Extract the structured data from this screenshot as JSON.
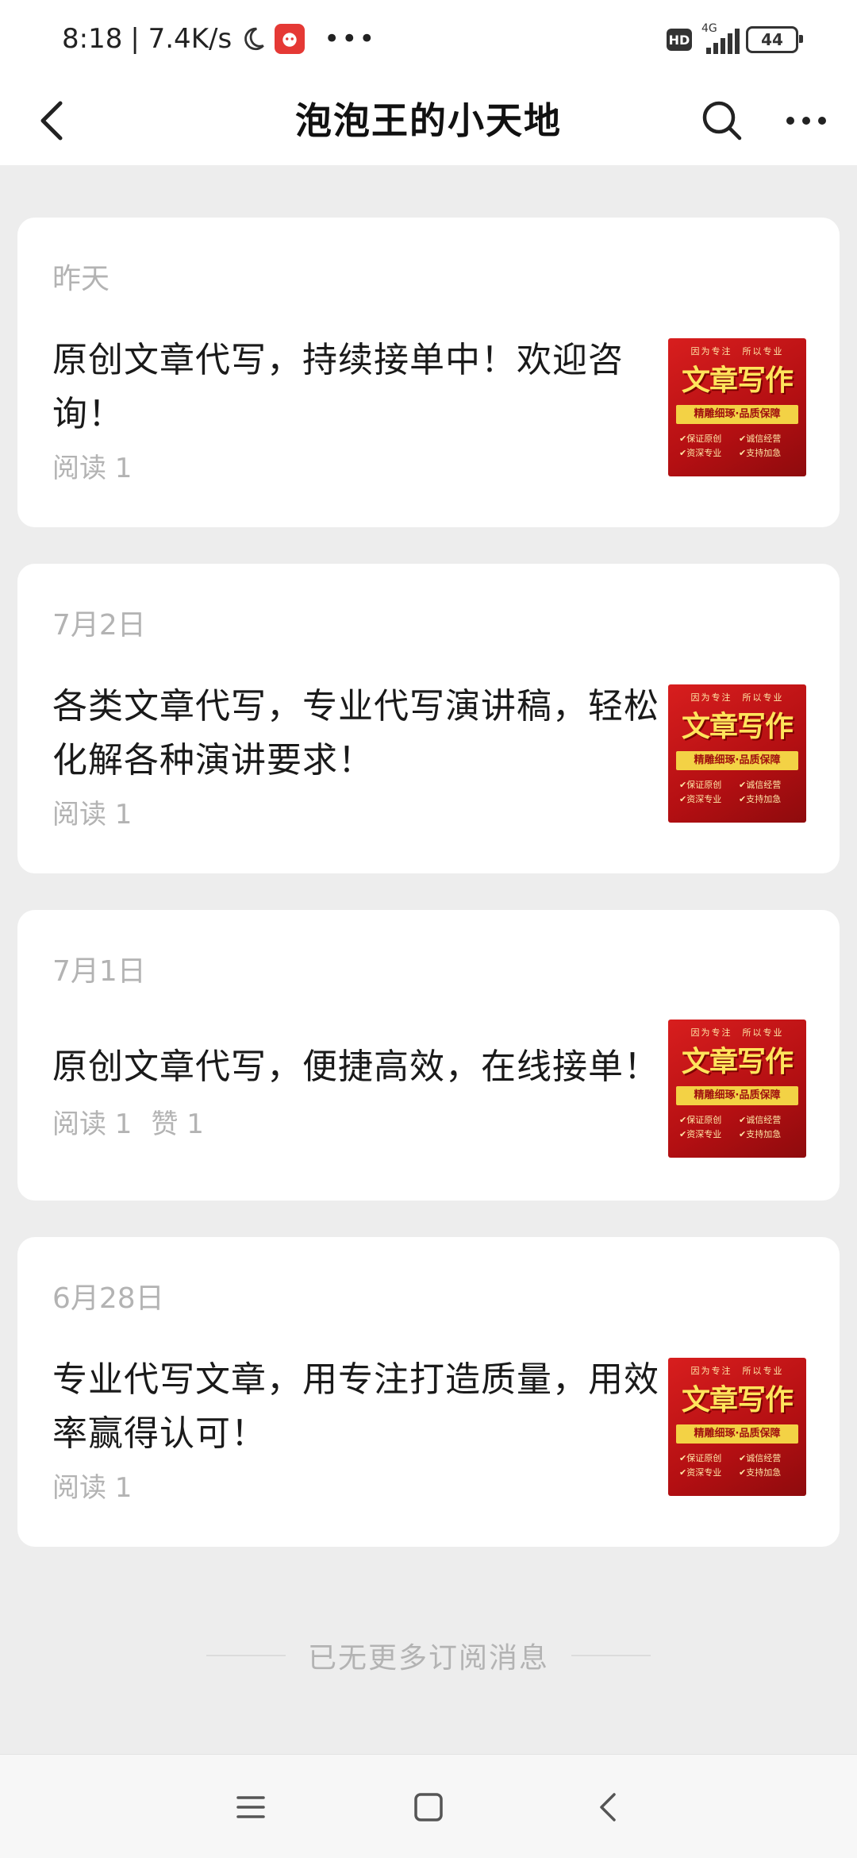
{
  "status_bar": {
    "time": "8:18",
    "speed": "| 7.4K/s",
    "hd": "HD",
    "network": "4G",
    "battery": "44"
  },
  "header": {
    "title": "泡泡王的小天地"
  },
  "thumbnail": {
    "top": "因为专注　所以专业",
    "main": "文章写作",
    "banner": "精雕细琢·品质保障",
    "bullets": [
      "✔保证原创",
      "✔诚信经营",
      "✔资深专业",
      "✔支持加急"
    ]
  },
  "articles": [
    {
      "date": "昨天",
      "title": "原创文章代写，持续接单中！欢迎咨询！",
      "stats": [
        "阅读 1"
      ]
    },
    {
      "date": "7月2日",
      "title": "各类文章代写，专业代写演讲稿，轻松化解各种演讲要求！",
      "stats": [
        "阅读 1"
      ]
    },
    {
      "date": "7月1日",
      "title": "原创文章代写，便捷高效，在线接单！",
      "stats": [
        "阅读 1",
        "赞 1"
      ]
    },
    {
      "date": "6月28日",
      "title": "专业代写文章，用专注打造质量，用效率赢得认可！",
      "stats": [
        "阅读 1"
      ]
    }
  ],
  "footer": {
    "end_text": "已无更多订阅消息"
  },
  "colors": {
    "background": "#ededed",
    "card": "#ffffff",
    "muted_text": "#b3b3b3",
    "thumb_red": "#c8161a"
  }
}
